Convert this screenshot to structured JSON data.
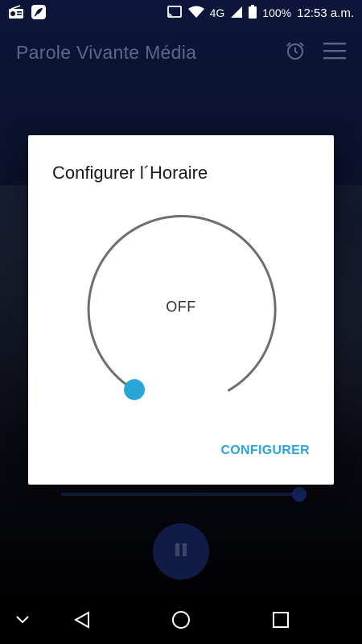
{
  "status_bar": {
    "battery": "100%",
    "time": "12:53 a.m.",
    "network": "4G"
  },
  "toolbar": {
    "title": "Parole Vivante Média"
  },
  "dialog": {
    "title": "Configurer l´Horaire",
    "dial_value": "OFF",
    "action_label": "CONFIGURER"
  },
  "colors": {
    "accent": "#2aa5d8",
    "dial_track": "#6e6e6e",
    "dialog_bg": "#ffffff"
  }
}
